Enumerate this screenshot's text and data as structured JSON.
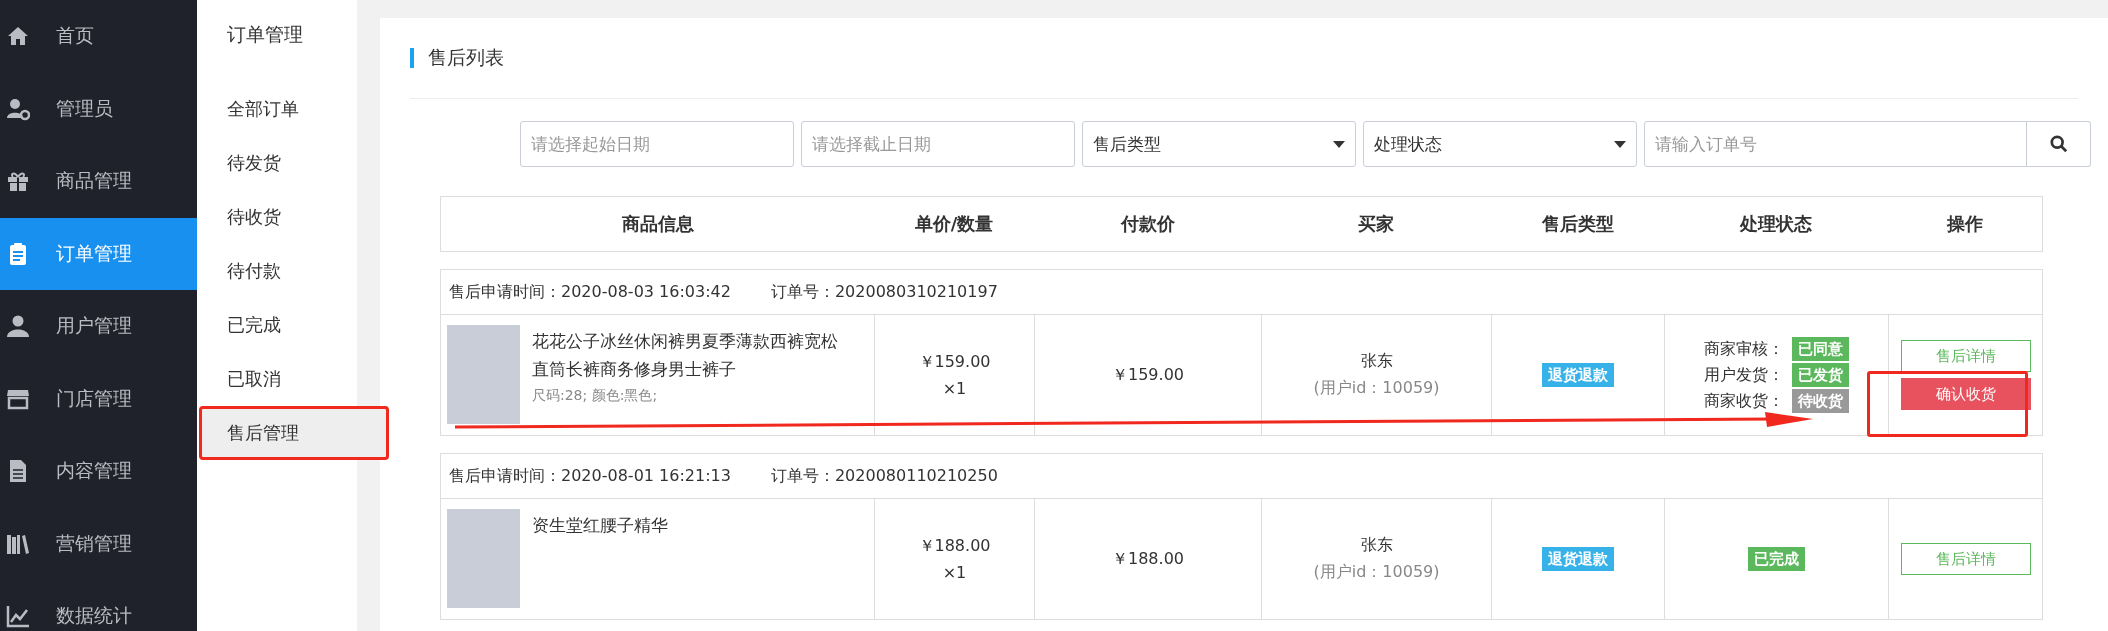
{
  "sidebar": {
    "items": [
      {
        "label": "首页",
        "selected": false
      },
      {
        "label": "管理员",
        "selected": false
      },
      {
        "label": "商品管理",
        "selected": false
      },
      {
        "label": "订单管理",
        "selected": true
      },
      {
        "label": "用户管理",
        "selected": false
      },
      {
        "label": "门店管理",
        "selected": false
      },
      {
        "label": "内容管理",
        "selected": false
      },
      {
        "label": "营销管理",
        "selected": false
      },
      {
        "label": "数据统计",
        "selected": false
      }
    ]
  },
  "submenu": {
    "title": "订单管理",
    "items": [
      {
        "label": "全部订单",
        "selected": false,
        "highlighted": false
      },
      {
        "label": "待发货",
        "selected": false,
        "highlighted": false
      },
      {
        "label": "待收货",
        "selected": false,
        "highlighted": false
      },
      {
        "label": "待付款",
        "selected": false,
        "highlighted": false
      },
      {
        "label": "已完成",
        "selected": false,
        "highlighted": false
      },
      {
        "label": "已取消",
        "selected": false,
        "highlighted": false
      },
      {
        "label": "售后管理",
        "selected": true,
        "highlighted": true
      }
    ]
  },
  "page_title": "售后列表",
  "filters": {
    "start_date": {
      "placeholder": "请选择起始日期"
    },
    "end_date": {
      "placeholder": "请选择截止日期"
    },
    "type_select": {
      "value": "售后类型"
    },
    "status_select": {
      "value": "处理状态"
    },
    "order_search": {
      "placeholder": "请输入订单号"
    }
  },
  "table": {
    "columns": [
      "商品信息",
      "单价/数量",
      "付款价",
      "买家",
      "售后类型",
      "处理状态",
      "操作"
    ],
    "orders": [
      {
        "time_label": "售后申请时间：",
        "time": "2020-08-03 16:03:42",
        "order_label": "订单号：",
        "order_no": "2020080310210197",
        "product": "花花公子冰丝休闲裤男夏季薄款西裤宽松直筒长裤商务修身男士裤子",
        "spec": "尺码:28; 颜色:黑色;",
        "unit_price": "￥159.00",
        "quantity": "×1",
        "paid": "￥159.00",
        "buyer": "张东",
        "buyer_id": "(用户id：10059)",
        "type": "退货退款",
        "status": {
          "kind": "steps",
          "steps": [
            {
              "label": "商家审核：",
              "value": "已同意",
              "color": "#5cb85c"
            },
            {
              "label": "用户发货：",
              "value": "已发货",
              "color": "#5cb85c"
            },
            {
              "label": "商家收货：",
              "value": "待收货",
              "color": "#999999"
            }
          ]
        },
        "actions": [
          {
            "label": "售后详情",
            "kind": "outline"
          },
          {
            "label": "确认收货",
            "kind": "danger"
          }
        ],
        "highlighted": true
      },
      {
        "time_label": "售后申请时间：",
        "time": "2020-08-01 16:21:13",
        "order_label": "订单号：",
        "order_no": "2020080110210250",
        "product": "资生堂红腰子精华",
        "unit_price": "￥188.00",
        "quantity": "×1",
        "paid": "￥188.00",
        "buyer": "张东",
        "buyer_id": "(用户id：10059)",
        "type": "退货退款",
        "status": {
          "kind": "badge",
          "value": "已完成",
          "color": "#5cb85c"
        },
        "actions": [
          {
            "label": "售后详情",
            "kind": "outline"
          }
        ],
        "highlighted": false
      }
    ]
  }
}
